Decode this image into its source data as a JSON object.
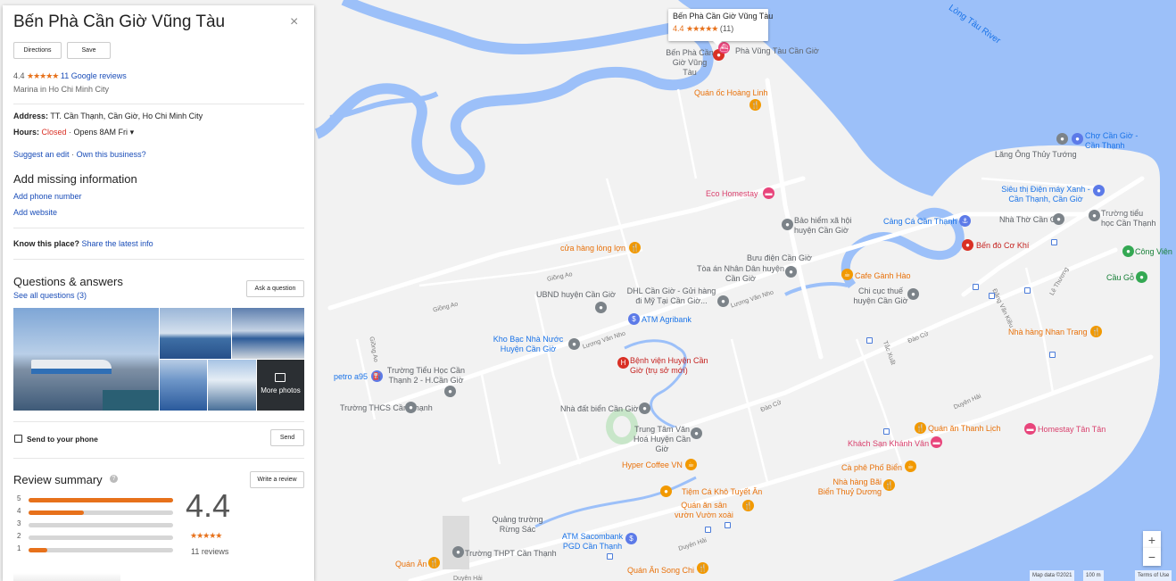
{
  "place": {
    "title": "Bến Phà Cần Giờ Vũng Tàu",
    "close_glyph": "×",
    "directions_label": "Directions",
    "save_label": "Save",
    "rating": "4.4",
    "stars": "★★★★★",
    "reviews_link": "11 Google reviews",
    "category": "Marina in Ho Chi Minh City",
    "address_label": "Address:",
    "address_value": "TT. Cần Thạnh, Cần Giờ, Ho Chi Minh City",
    "hours_label": "Hours:",
    "hours_status": "Closed",
    "hours_sep": " · ",
    "hours_opens": "Opens 8AM Fri",
    "hours_caret": "▾",
    "suggest_edit": "Suggest an edit",
    "own_business": "Own this business?",
    "missing_heading": "Add missing information",
    "add_phone": "Add phone number",
    "add_website": "Add website",
    "know_label": "Know this place?",
    "share_info": "Share the latest info",
    "qa_heading": "Questions & answers",
    "qa_see_all": "See all questions (3)",
    "ask_question": "Ask a question",
    "more_photos": "More photos",
    "send_to_phone": "Send to your phone",
    "send_label": "Send",
    "review_summary": "Review summary",
    "write_review": "Write a review",
    "big_rating": "4.4",
    "review_count": "11 reviews",
    "rating_bars": [
      {
        "star": "5",
        "fraction": 1.0
      },
      {
        "star": "4",
        "fraction": 0.38
      },
      {
        "star": "3",
        "fraction": 0.0
      },
      {
        "star": "2",
        "fraction": 0.0
      },
      {
        "star": "1",
        "fraction": 0.13
      }
    ]
  },
  "bubble": {
    "title": "Bến Phà Cần Giờ Vũng Tàu",
    "rating": "4.4",
    "stars": "★★★★★",
    "count": "(11)"
  },
  "map": {
    "labels": {
      "long_tau_river": "Lòng Tàu River",
      "ben_pha_pin": "Bến Phà Cần Giờ Vũng Tàu",
      "pha_vung_tau": "Phà Vũng Tàu Cần Giờ",
      "quan_oc_hoang_linh": "Quán ốc Hoàng Linh",
      "cho_can_gio": "Chợ Cần Giờ - Cần Thạnh",
      "lang_ong": "Lăng Ông Thủy Tướng",
      "sieu_thi": "Siêu thị Điện máy Xanh - Cần Thạnh, Cần Giờ",
      "eco_homestay": "Eco Homestay",
      "bao_hiem": "Bảo hiểm xã hội huyện Cần Giờ",
      "cang_ca": "Cảng Cá Cần Thạnh",
      "nha_tho": "Nhà Thờ Cần Giờ",
      "truong_tieu_hoc": "Trường tiểu học Cần Thạnh",
      "ben_do_co_khi": "Bến đò Cơ Khí",
      "cong_vien": "Công Viên",
      "cau_go": "Cầu Gỗ",
      "cua_hang_long_lon": "cửa hàng lòng lợn",
      "buu_dien": "Bưu điện Cần Giờ",
      "toa_an": "Tòa án Nhân Dân huyện Cần Giờ",
      "cafe_ganh_hao": "Cafe Gành Hào",
      "ubnd": "UBND huyện Cần Giờ",
      "dhl": "DHL Cần Giờ - Gửi hàng đi Mỹ Tại Cần Giờ...",
      "chi_cuc_thue": "Chi cục thuế huyện Cần Giờ",
      "atm_agribank": "ATM Agribank",
      "kho_bac": "Kho Bạc Nhà Nước Huyện Cần Giờ",
      "benh_vien": "Bệnh viện Huyện Cần Giờ (trụ sở mới)",
      "nha_hang_nhan_trang": "Nhà hàng Nhan Trang",
      "petro": "petro a95",
      "truong_tieu_hoc_2": "Trường Tiểu Học Cần Thạnh 2 - H.Cần Giờ",
      "truong_thcs": "Trường THCS Cần Thạnh",
      "nha_dat_bien": "Nhà đất biển Cần Giờ",
      "trung_tam_van_hoa": "Trung Tâm Văn Hoá Huyện Cần Giờ",
      "quan_an_thanh_lich": "Quán ăn Thanh Lịch",
      "homestay_tan_tan": "Homestay Tân Tân",
      "khach_san_khanh_van": "Khách Sạn Khánh Vân",
      "hyper_coffee": "Hyper Coffee VN",
      "ca_phe_pho_bien": "Cà phê Phố Biển",
      "nha_hang_bai_bien": "Nhà hàng Bãi Biển Thuỷ Dương",
      "tiem_ca_kho": "Tiệm Cá Khô Tuyết Ân",
      "quan_an_san_vuon": "Quán ăn sân vườn Vườn xoài",
      "quang_truong": "Quảng trường Rừng Sác",
      "atm_sacombank": "ATM Sacombank PGD Cần Thạnh",
      "quan_an": "Quán Ăn",
      "truong_thpt": "Trường THPT Cần Thạnh",
      "quan_an_song_chi": "Quán Ăn Song Chi",
      "road_giong_ao": "Giồng Ao",
      "road_giong_ao2": "Giồng Ao",
      "road_giong_ao3": "Giồng Ao",
      "road_luong_van_nho": "Lương Văn Nho",
      "road_luong_van_nho2": "Lương Văn Nho",
      "road_dao_cu": "Đào Cử",
      "road_dao_cu2": "Đào Cử",
      "road_duyen_hai": "Duyên Hải",
      "road_duyen_hai2": "Duyên Hải",
      "road_tac_xuat": "Tắc Xuất",
      "road_dang_van_kieu": "Đặng Văn Kiều",
      "road_le_thuong": "Lê Thương",
      "road_duyen_hai3": "Duyên Hải"
    },
    "zoom_in": "+",
    "zoom_out": "−",
    "attribution_data": "Map data ©2021",
    "attribution_scale": "100 m",
    "attribution_terms": "Terms of Use"
  }
}
